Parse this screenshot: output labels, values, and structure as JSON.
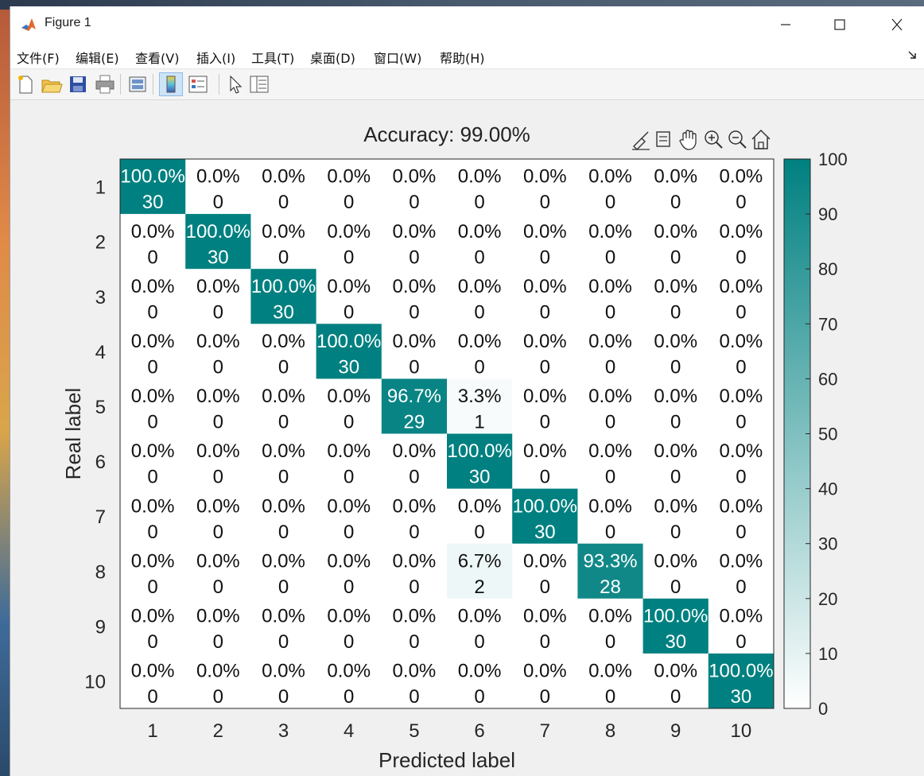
{
  "window": {
    "title": "Figure 1"
  },
  "menu": {
    "items": [
      "文件(F)",
      "编辑(E)",
      "查看(V)",
      "插入(I)",
      "工具(T)",
      "桌面(D)",
      "窗口(W)",
      "帮助(H)"
    ]
  },
  "toolbar": {
    "icons": [
      "new-figure-icon",
      "open-file-icon",
      "save-icon",
      "print-icon",
      "link-plot-icon",
      "colorbar-icon",
      "legend-icon",
      "edit-plot-icon",
      "property-inspector-icon"
    ]
  },
  "axes_toolbar": {
    "icons": [
      "brush-icon",
      "data-tips-icon",
      "pan-icon",
      "zoom-in-icon",
      "zoom-out-icon",
      "home-icon"
    ]
  },
  "colors": {
    "accent": "#008080",
    "low": "#ffffff"
  },
  "chart_data": {
    "type": "heatmap",
    "title": "Accuracy: 99.00%",
    "xlabel": "Predicted label",
    "ylabel": "Real label",
    "x_categories": [
      "1",
      "2",
      "3",
      "4",
      "5",
      "6",
      "7",
      "8",
      "9",
      "10"
    ],
    "y_categories": [
      "1",
      "2",
      "3",
      "4",
      "5",
      "6",
      "7",
      "8",
      "9",
      "10"
    ],
    "counts": [
      [
        30,
        0,
        0,
        0,
        0,
        0,
        0,
        0,
        0,
        0
      ],
      [
        0,
        30,
        0,
        0,
        0,
        0,
        0,
        0,
        0,
        0
      ],
      [
        0,
        0,
        30,
        0,
        0,
        0,
        0,
        0,
        0,
        0
      ],
      [
        0,
        0,
        0,
        30,
        0,
        0,
        0,
        0,
        0,
        0
      ],
      [
        0,
        0,
        0,
        0,
        29,
        1,
        0,
        0,
        0,
        0
      ],
      [
        0,
        0,
        0,
        0,
        0,
        30,
        0,
        0,
        0,
        0
      ],
      [
        0,
        0,
        0,
        0,
        0,
        0,
        30,
        0,
        0,
        0
      ],
      [
        0,
        0,
        0,
        0,
        0,
        2,
        0,
        28,
        0,
        0
      ],
      [
        0,
        0,
        0,
        0,
        0,
        0,
        0,
        0,
        30,
        0
      ],
      [
        0,
        0,
        0,
        0,
        0,
        0,
        0,
        0,
        0,
        30
      ]
    ],
    "percentages": [
      [
        "100.0%",
        "0.0%",
        "0.0%",
        "0.0%",
        "0.0%",
        "0.0%",
        "0.0%",
        "0.0%",
        "0.0%",
        "0.0%"
      ],
      [
        "0.0%",
        "100.0%",
        "0.0%",
        "0.0%",
        "0.0%",
        "0.0%",
        "0.0%",
        "0.0%",
        "0.0%",
        "0.0%"
      ],
      [
        "0.0%",
        "0.0%",
        "100.0%",
        "0.0%",
        "0.0%",
        "0.0%",
        "0.0%",
        "0.0%",
        "0.0%",
        "0.0%"
      ],
      [
        "0.0%",
        "0.0%",
        "0.0%",
        "100.0%",
        "0.0%",
        "0.0%",
        "0.0%",
        "0.0%",
        "0.0%",
        "0.0%"
      ],
      [
        "0.0%",
        "0.0%",
        "0.0%",
        "0.0%",
        "96.7%",
        "3.3%",
        "0.0%",
        "0.0%",
        "0.0%",
        "0.0%"
      ],
      [
        "0.0%",
        "0.0%",
        "0.0%",
        "0.0%",
        "0.0%",
        "100.0%",
        "0.0%",
        "0.0%",
        "0.0%",
        "0.0%"
      ],
      [
        "0.0%",
        "0.0%",
        "0.0%",
        "0.0%",
        "0.0%",
        "0.0%",
        "100.0%",
        "0.0%",
        "0.0%",
        "0.0%"
      ],
      [
        "0.0%",
        "0.0%",
        "0.0%",
        "0.0%",
        "0.0%",
        "6.7%",
        "0.0%",
        "93.3%",
        "0.0%",
        "0.0%"
      ],
      [
        "0.0%",
        "0.0%",
        "0.0%",
        "0.0%",
        "0.0%",
        "0.0%",
        "0.0%",
        "0.0%",
        "100.0%",
        "0.0%"
      ],
      [
        "0.0%",
        "0.0%",
        "0.0%",
        "0.0%",
        "0.0%",
        "0.0%",
        "0.0%",
        "0.0%",
        "0.0%",
        "100.0%"
      ]
    ],
    "colorbar": {
      "min": 0,
      "max": 100,
      "ticks": [
        0,
        10,
        20,
        30,
        40,
        50,
        60,
        70,
        80,
        90,
        100
      ]
    },
    "grid": false
  }
}
